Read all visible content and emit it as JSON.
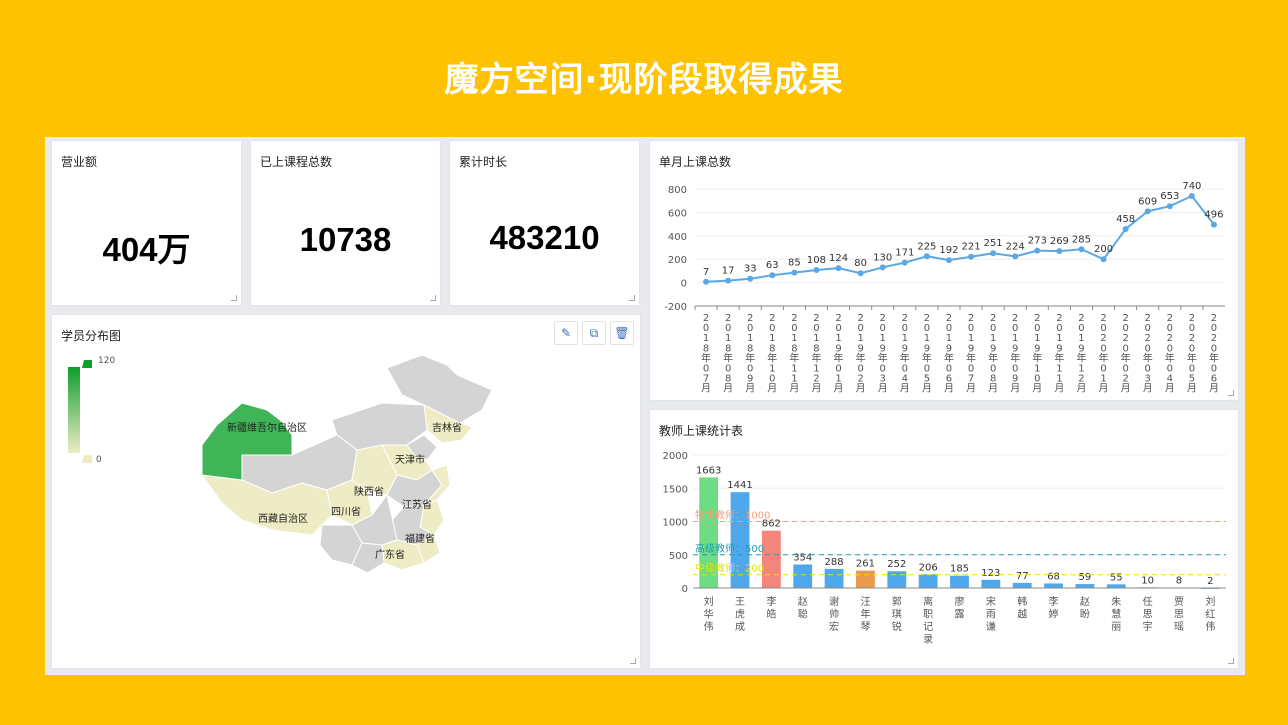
{
  "page": {
    "title": "魔方空间·现阶段取得成果"
  },
  "kpis": [
    {
      "label": "营业额",
      "value": "404万"
    },
    {
      "label": "已上课程总数",
      "value": "10738"
    },
    {
      "label": "累计时长",
      "value": "483210"
    }
  ],
  "map_card": {
    "title": "学员分布图",
    "legend": {
      "max": "120",
      "min": "0"
    },
    "regions": [
      "新疆维吾尔自治区",
      "吉林省",
      "天津市",
      "陕西省",
      "江苏省",
      "四川省",
      "西藏自治区",
      "福建省",
      "广东省"
    ],
    "toolbar": [
      {
        "icon": "edit-icon",
        "glyph": "✎"
      },
      {
        "icon": "copy-icon",
        "glyph": "⧉"
      },
      {
        "icon": "delete-icon",
        "glyph": "🗑"
      }
    ]
  },
  "line_card": {
    "title": "单月上课总数"
  },
  "bar_card": {
    "title": "教师上课统计表"
  },
  "colors": {
    "background": "#FFC200",
    "line": "#5BA8E6",
    "bar_blue": "#4FA8EC",
    "bar_green": "#6DDC84",
    "bar_red": "#F4857A",
    "bar_orange": "#E99A4E",
    "map_green": "#3FB558",
    "map_light": "#EEECC4",
    "map_gray": "#D4D4D4"
  },
  "chart_data": [
    {
      "type": "line",
      "title": "单月上课总数",
      "categories": [
        "2018年07月",
        "2018年08月",
        "2018年09月",
        "2018年10月",
        "2018年11月",
        "2018年12月",
        "2019年01月",
        "2019年02月",
        "2019年03月",
        "2019年04月",
        "2019年05月",
        "2019年06月",
        "2019年07月",
        "2019年08月",
        "2019年09月",
        "2019年10月",
        "2019年11月",
        "2019年12月",
        "2020年01月",
        "2020年02月",
        "2020年03月",
        "2020年04月",
        "2020年05月",
        "2020年06月"
      ],
      "values": [
        7,
        17,
        33,
        63,
        85,
        108,
        124,
        80,
        130,
        171,
        225,
        192,
        221,
        251,
        224,
        273,
        269,
        285,
        200,
        458,
        609,
        653,
        740,
        496
      ],
      "ylim": [
        -200,
        800
      ],
      "yticks": [
        -200,
        0,
        200,
        400,
        600,
        800
      ]
    },
    {
      "type": "bar",
      "title": "教师上课统计表",
      "categories": [
        "刘华伟",
        "王虎成",
        "李皓",
        "赵聪",
        "谢帅宏",
        "汪年琴",
        "郭琪锐",
        "离职记录",
        "廖露",
        "宋雨谦",
        "韩越",
        "李婷",
        "赵盼",
        "朱慧丽",
        "任思宇",
        "贾思瑶",
        "刘红伟"
      ],
      "values": [
        1663,
        1441,
        862,
        354,
        288,
        261,
        252,
        206,
        185,
        123,
        77,
        68,
        59,
        55,
        10,
        8,
        2
      ],
      "bar_colors": [
        "green",
        "blue",
        "red",
        "blue",
        "blue",
        "orange",
        "blue",
        "blue",
        "blue",
        "blue",
        "blue",
        "blue",
        "blue",
        "blue",
        "blue",
        "blue",
        "blue"
      ],
      "ylim": [
        0,
        2000
      ],
      "yticks": [
        0,
        500,
        1000,
        1500,
        2000
      ],
      "reference_lines": [
        {
          "label": "特级教师：1000",
          "value": 1000,
          "color": "#F4A07A"
        },
        {
          "label": "高级教师：500",
          "value": 500,
          "color": "#1C9FB5"
        },
        {
          "label": "中级教师：200",
          "value": 200,
          "color": "#E8E000"
        }
      ]
    }
  ]
}
